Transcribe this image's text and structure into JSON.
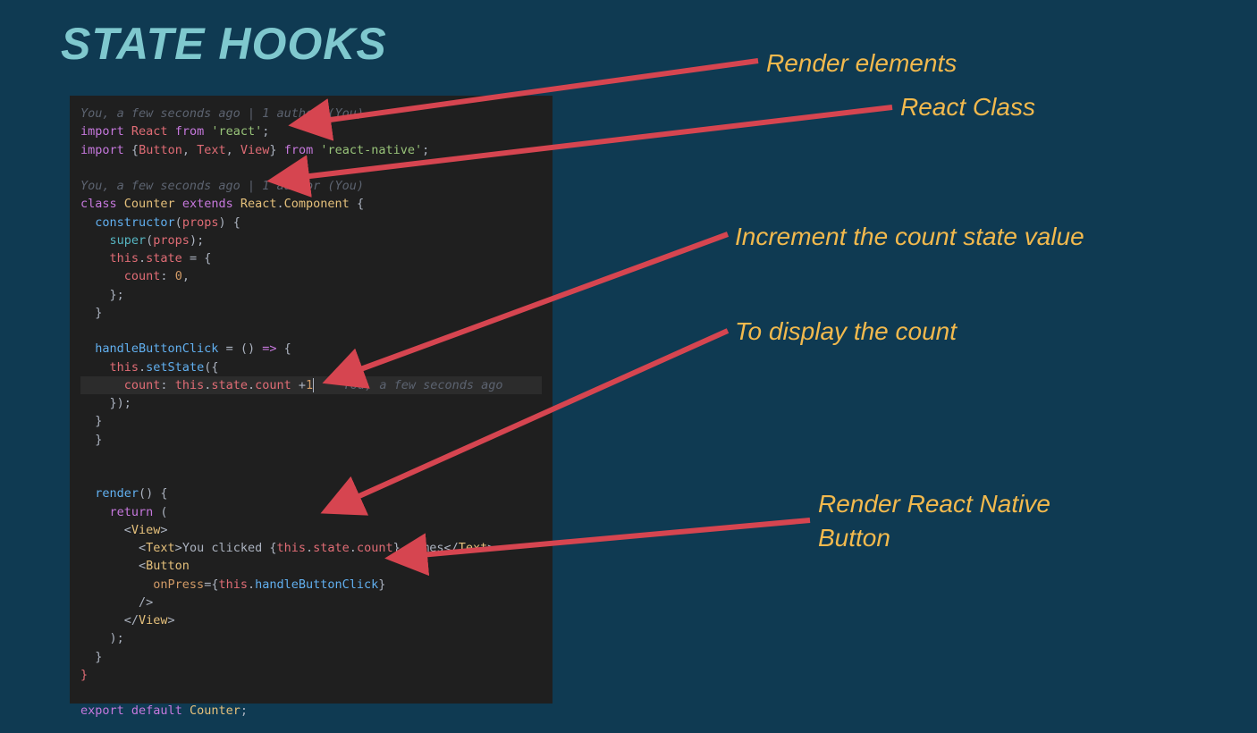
{
  "title": "STATE HOOKS",
  "annotations": {
    "render_elements": "Render elements",
    "react_class": "React Class",
    "increment": "Increment the count state value",
    "display_count": "To display the count",
    "native_button": "Render React Native Button"
  },
  "code": {
    "lens1": "You, a few seconds ago | 1 author (You)",
    "l1_a": "import",
    "l1_b": "React",
    "l1_c": "from",
    "l1_d": "'react'",
    "l1_e": ";",
    "l2_a": "import",
    "l2_b": "{",
    "l2_c": "Button",
    "l2_d": ", ",
    "l2_e": "Text",
    "l2_f": ", ",
    "l2_g": "View",
    "l2_h": "}",
    "l2_i": "from",
    "l2_j": "'react-native'",
    "l2_k": ";",
    "lens2": "You, a few seconds ago | 1 author (You)",
    "l3_a": "class",
    "l3_b": "Counter",
    "l3_c": "extends",
    "l3_d": "React",
    "l3_e": ".",
    "l3_f": "Component",
    "l3_g": " {",
    "l4_a": "  ",
    "l4_b": "constructor",
    "l4_c": "(",
    "l4_d": "props",
    "l4_e": ") {",
    "l5_a": "    ",
    "l5_b": "super",
    "l5_c": "(",
    "l5_d": "props",
    "l5_e": ");",
    "l6_a": "    ",
    "l6_b": "this",
    "l6_c": ".",
    "l6_d": "state",
    "l6_e": " = {",
    "l7_a": "      ",
    "l7_b": "count",
    "l7_c": ": ",
    "l7_d": "0",
    "l7_e": ",",
    "l8": "    };",
    "l9": "  }",
    "l10_a": "  ",
    "l10_b": "handleButtonClick",
    "l10_c": " = () ",
    "l10_d": "=>",
    "l10_e": " {",
    "l11_a": "    ",
    "l11_b": "this",
    "l11_c": ".",
    "l11_d": "setState",
    "l11_e": "({",
    "l12_a": "      ",
    "l12_b": "count",
    "l12_c": ": ",
    "l12_d": "this",
    "l12_e": ".",
    "l12_f": "state",
    "l12_g": ".",
    "l12_h": "count",
    "l12_i": " +",
    "l12_j": "1",
    "l12_lens": "    You, a few seconds ago",
    "l13": "    });",
    "l14": "  }",
    "l15": "  }",
    "l16_a": "  ",
    "l16_b": "render",
    "l16_c": "() {",
    "l17_a": "    ",
    "l17_b": "return",
    "l17_c": " (",
    "l18_a": "      <",
    "l18_b": "View",
    "l18_c": ">",
    "l19_a": "        <",
    "l19_b": "Text",
    "l19_c": ">",
    "l19_d": "You clicked ",
    "l19_e": "{",
    "l19_f": "this",
    "l19_g": ".",
    "l19_h": "state",
    "l19_i": ".",
    "l19_j": "count",
    "l19_k": "}",
    "l19_l": " times",
    "l19_m": "</",
    "l19_n": "Text",
    "l19_o": ">",
    "l20_a": "        <",
    "l20_b": "Button",
    "l21_a": "          ",
    "l21_b": "onPress",
    "l21_c": "=",
    "l21_d": "{",
    "l21_e": "this",
    "l21_f": ".",
    "l21_g": "handleButtonClick",
    "l21_h": "}",
    "l22": "        />",
    "l23_a": "      </",
    "l23_b": "View",
    "l23_c": ">",
    "l24": "    );",
    "l25": "  }",
    "l26": "}",
    "l27_a": "export",
    "l27_b": "default",
    "l27_c": "Counter",
    "l27_d": ";"
  }
}
